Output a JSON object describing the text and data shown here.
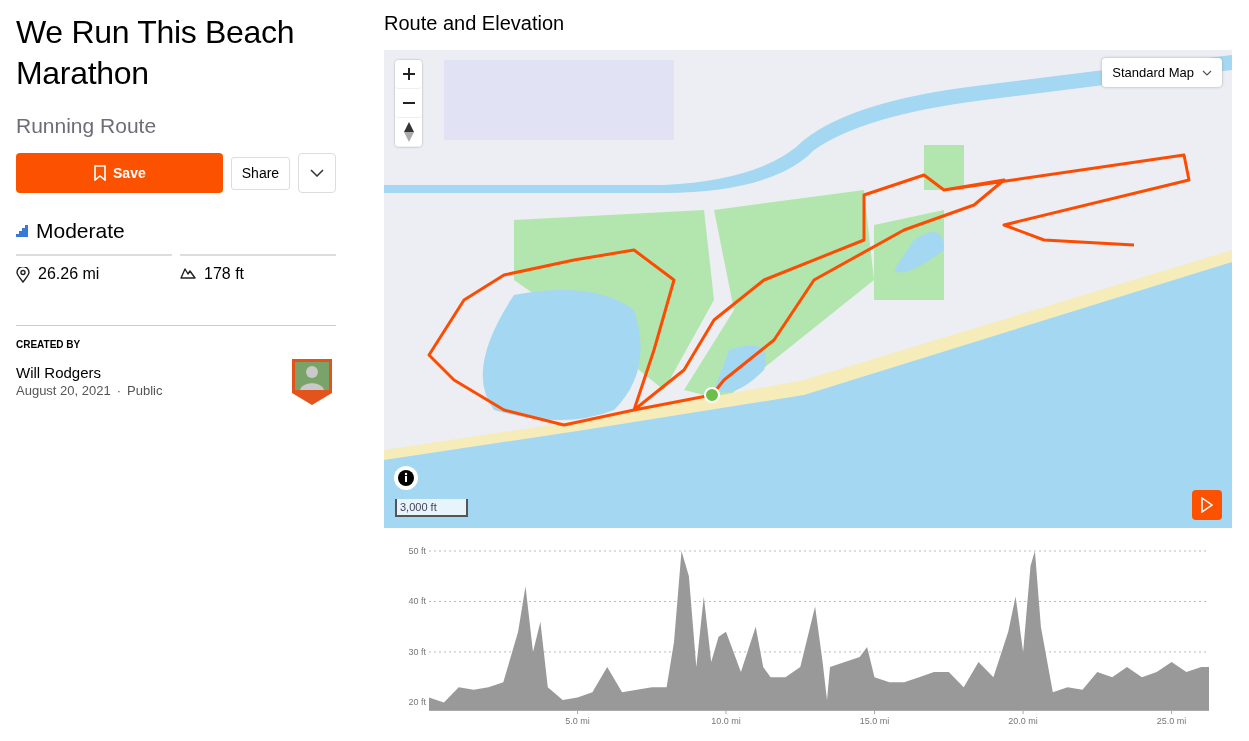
{
  "header": {
    "title": "We Run This Beach Marathon",
    "subtitle": "Running Route"
  },
  "actions": {
    "save": "Save",
    "share": "Share"
  },
  "difficulty": {
    "label": "Moderate"
  },
  "stats": [
    {
      "kind": "distance",
      "value": "26.26 mi"
    },
    {
      "kind": "elevation",
      "value": "178 ft"
    }
  ],
  "creator": {
    "heading": "CREATED BY",
    "name": "Will Rodgers",
    "date": "August 20, 2021",
    "separator": "·",
    "visibility": "Public"
  },
  "route_section": {
    "title": "Route and Elevation",
    "map_type": "Standard Map",
    "scale": "3,000 ft"
  },
  "elevation": {
    "chart_data": {
      "type": "area",
      "grid": true,
      "xlim": [
        0,
        26.26
      ],
      "ylim": [
        18.5,
        50
      ],
      "xticks": [
        {
          "value": 5,
          "label": "5.0 mi"
        },
        {
          "value": 10,
          "label": "10.0 mi"
        },
        {
          "value": 15,
          "label": "15.0 mi"
        },
        {
          "value": 20,
          "label": "20.0 mi"
        },
        {
          "value": 25,
          "label": "25.0 mi"
        }
      ],
      "yticks": [
        {
          "value": 20,
          "label": "20 ft"
        },
        {
          "value": 30,
          "label": "30 ft"
        },
        {
          "value": 40,
          "label": "40 ft"
        },
        {
          "value": 50,
          "label": "50 ft"
        }
      ],
      "x": [
        0,
        0.5,
        1,
        1.5,
        2,
        2.5,
        3,
        3.25,
        3.5,
        3.75,
        4,
        4.5,
        5,
        5.5,
        6,
        6.5,
        7,
        7.5,
        8,
        8.25,
        8.5,
        8.75,
        9,
        9.25,
        9.5,
        9.75,
        10,
        10.5,
        11,
        11.25,
        11.5,
        12,
        12.5,
        13,
        13.25,
        13.4,
        13.5,
        14,
        14.5,
        14.75,
        15,
        15.5,
        16,
        16.5,
        17,
        17.5,
        18,
        18.5,
        19,
        19.5,
        19.75,
        20,
        20.25,
        20.4,
        20.6,
        21,
        21.5,
        22,
        22.5,
        23,
        23.5,
        24,
        24.5,
        25,
        25.5,
        26,
        26.26
      ],
      "series": [
        {
          "color": "#999999",
          "values": [
            21,
            20,
            23,
            22.5,
            23,
            24,
            34,
            43,
            30,
            36,
            23,
            20.5,
            21,
            22,
            27,
            22,
            22.5,
            23,
            23,
            32,
            50,
            45,
            27,
            41,
            28,
            33,
            34,
            26,
            35,
            27,
            25,
            25,
            27,
            39,
            28,
            20.5,
            27,
            28,
            29,
            31,
            25,
            24,
            24,
            25,
            26,
            26,
            23,
            28,
            25,
            34,
            41,
            30,
            47,
            50,
            35,
            22,
            23,
            22.5,
            26,
            25,
            27,
            25,
            26,
            28,
            26,
            27,
            27
          ]
        }
      ]
    }
  }
}
